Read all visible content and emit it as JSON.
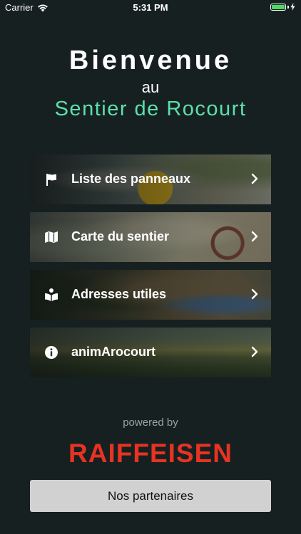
{
  "status_bar": {
    "carrier": "Carrier",
    "time": "5:31 PM",
    "battery_color": "#4cd964"
  },
  "header": {
    "welcome": "Bienvenue",
    "au": "au",
    "trail_name": "Sentier de Rocourt",
    "trail_color": "#5be0ad"
  },
  "menu": {
    "items": [
      {
        "icon": "flag-icon",
        "label": "Liste des panneaux"
      },
      {
        "icon": "map-icon",
        "label": "Carte du sentier"
      },
      {
        "icon": "book-reader-icon",
        "label": "Adresses utiles"
      },
      {
        "icon": "info-icon",
        "label": "animArocourt"
      }
    ]
  },
  "footer": {
    "powered_by": "powered by",
    "brand": "RAIFFEISEN",
    "brand_color": "#e63322",
    "partners_button": "Nos partenaires"
  }
}
